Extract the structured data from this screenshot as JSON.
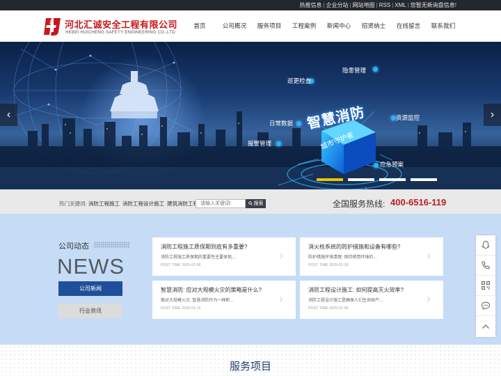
{
  "topbar": {
    "links": [
      "热推信息",
      "企业分站",
      "网站地图",
      "RSS",
      "XML",
      "您暂无新询盘信息!"
    ]
  },
  "header": {
    "logo_text": "HJ",
    "company_cn": "河北汇诚安全工程有限公司",
    "company_en": "HEBEI HUICHENG SAFETY ENGINEERING CO.,LTD",
    "nav": [
      "首页",
      "公司概况",
      "服务项目",
      "工程案例",
      "新闻中心",
      "招贤纳士",
      "在线留言",
      "联系我们"
    ]
  },
  "banner": {
    "title": "智慧消防",
    "subtitle": "城市守护者",
    "keywords": {
      "inspect": "巡更检查",
      "hazard": "隐患管理",
      "daily": "日常数据",
      "resource": "资源监控",
      "alarm": "报警管理",
      "emergency": "应急预案"
    },
    "prev_glyph": "‹",
    "next_glyph": "›",
    "slide_count": 4,
    "active_slide": 1
  },
  "search": {
    "hot_label": "热门关键词:",
    "hot_keywords": [
      "消防工程施工",
      "消防工程设计施工",
      "建筑消防工程"
    ],
    "placeholder": "请输入关键词!",
    "button_label": "搜索",
    "hotline_label": "全国服务热线:",
    "hotline_number": "400-6516-119"
  },
  "news": {
    "section_title": "公司动态",
    "big_label": "NEWS",
    "tabs": [
      "公司新闻",
      "行业资讯"
    ],
    "items": [
      {
        "title": "消防工程施工质保期到底有多重要?",
        "summary": "消防工程施工质保期的重要性主要体现...",
        "date": "POST TIME  2025-02-06"
      },
      {
        "title": "消火栓系统的防护措施和设备有哪些?",
        "summary": "防护措施环境清理: 保持使用环境的...",
        "date": "POST TIME  2025-01-20"
      },
      {
        "title": "智慧消防: 应对大规模火灾的策略是什么?",
        "summary": "面对大规模火灾, 智慧消防作为一种新...",
        "date": "POST TIME  2025-01-15"
      },
      {
        "title": "消防工程设计施工: 如何提高灭火效率?",
        "summary": "消防工程设计施工是确保人们生命财产...",
        "date": "POST TIME  2025-01-06"
      }
    ],
    "chevron_glyph": "›"
  },
  "services": {
    "title": "服务项目"
  },
  "colors": {
    "brand_red": "#c8161d",
    "topbar_bg": "#23272e",
    "news_bg": "#c6dcf6",
    "tab_active": "#1f4f9a",
    "hotline_red": "#b81c22",
    "slider_active": "#f2c200"
  },
  "float_toolbar": [
    "qq-icon",
    "phone-icon",
    "qrcode-icon",
    "chat-icon",
    "back-to-top-icon"
  ]
}
